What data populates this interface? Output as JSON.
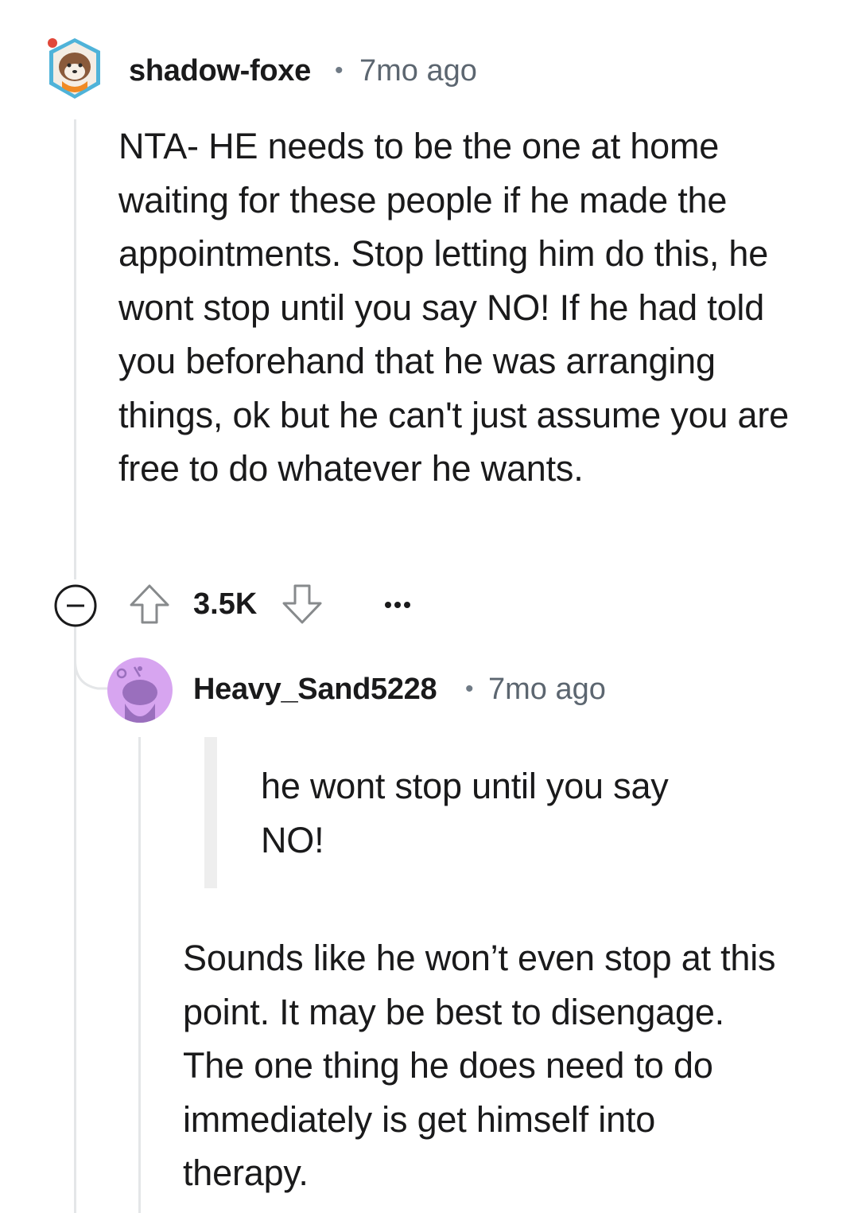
{
  "comment": {
    "username": "shadow-foxe",
    "separator": "•",
    "timestamp": "7mo ago",
    "body": "NTA- HE needs to be the one at home waiting for these people if he made the appointments. Stop letting him do this, he wont stop until you say NO! If he had told you beforehand that he was arranging things, ok but he can't just assume you are free to do whatever he wants.",
    "score": "3.5K",
    "icons": {
      "collapse": "collapse-minus-icon",
      "upvote": "upvote-arrow-icon",
      "downvote": "downvote-arrow-icon",
      "more": "more-options-icon"
    }
  },
  "reply": {
    "username": "Heavy_Sand5228",
    "separator": "•",
    "timestamp": "7mo ago",
    "quote": "he wont stop until you say NO!",
    "body": "Sounds like he won’t even stop at this point. It may be best to disengage. The one thing he does need to do immediately is get himself into therapy."
  },
  "colors": {
    "text": "#1a1a1b",
    "meta": "#5c6670",
    "thread_line": "#e4e6e8",
    "quote_bar": "#eeeeee",
    "reply_avatar_bg": "#d7a5f0",
    "reply_avatar_fg": "#9a6fbd"
  }
}
